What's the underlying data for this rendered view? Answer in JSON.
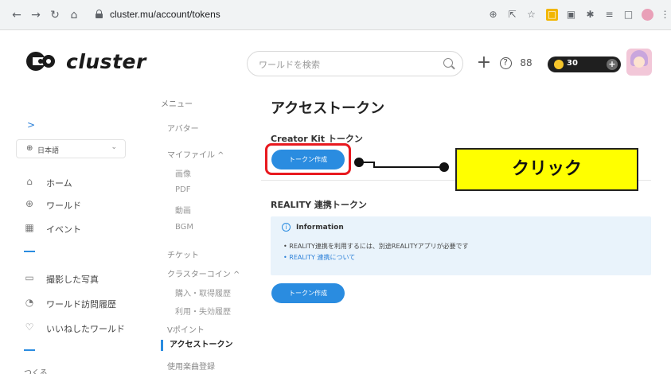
{
  "browser": {
    "url": "cluster.mu/account/tokens"
  },
  "header": {
    "logo_text": "cluster",
    "search_placeholder": "ワールドを検索",
    "coin_count": "30",
    "coin_plus": "+",
    "add_icon": "+",
    "help_icon": "?",
    "people_icon": "88"
  },
  "sidebar": {
    "expand_icon": ">",
    "language": "日本語",
    "items": [
      {
        "icon": "home-icon",
        "label": "ホーム"
      },
      {
        "icon": "globe-icon",
        "label": "ワールド"
      },
      {
        "icon": "calendar-icon",
        "label": "イベント"
      },
      {
        "icon": "photo-icon",
        "label": "撮影した写真"
      },
      {
        "icon": "history-icon",
        "label": "ワールド訪問履歴"
      },
      {
        "icon": "heart-icon",
        "label": "いいねしたワールド"
      }
    ],
    "create_label": "つくる"
  },
  "menu": {
    "title": "メニュー",
    "avatar": "アバター",
    "my_files": "マイファイル ^",
    "images": "画像",
    "pdf": "PDF",
    "video": "動画",
    "bgm": "BGM",
    "tickets": "チケット",
    "cluster_coin": "クラスターコイン ^",
    "purchase_history": "購入・取得履歴",
    "usage_history": "利用・失効履歴",
    "v_points": "Vポイント",
    "access_token": "アクセストークン",
    "music_registration": "使用楽曲登録"
  },
  "main": {
    "title": "アクセストークン",
    "creator_kit_title": "Creator Kit トークン",
    "create_token_label": "トークン作成",
    "reality_title": "REALITY 連携トークン",
    "info_title": "Information",
    "info_line1": "• REALITY連携を利用するには、別途REALITYアプリが必要です",
    "info_line2": "• REALITY 連携について",
    "reality_button_label": "トークン作成"
  },
  "annotation": {
    "callout_text": "クリック",
    "highlight_color": "#e8191f",
    "callout_color": "#ffff00"
  },
  "colors": {
    "accent": "#2a8ce0"
  }
}
